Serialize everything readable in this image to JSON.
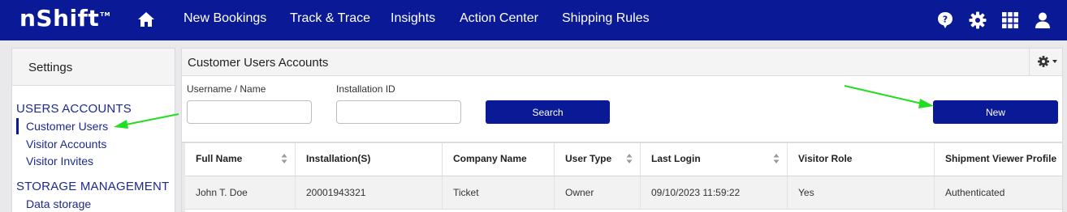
{
  "brand": {
    "logo_text": "nShift",
    "logo_tm": "TM"
  },
  "topnav": {
    "items": [
      {
        "label": "New Bookings"
      },
      {
        "label": "Track & Trace"
      },
      {
        "label": "Insights"
      },
      {
        "label": "Action Center"
      },
      {
        "label": "Shipping Rules"
      }
    ],
    "icons": [
      "home-icon",
      "help-icon",
      "settings-gear-icon",
      "apps-grid-icon",
      "user-icon"
    ]
  },
  "sidebar": {
    "title": "Settings",
    "sections": [
      {
        "label": "USERS ACCOUNTS",
        "items": [
          {
            "label": "Customer Users",
            "active": true
          },
          {
            "label": "Visitor Accounts"
          },
          {
            "label": "Visitor Invites"
          }
        ]
      },
      {
        "label": "STORAGE MANAGEMENT",
        "items": [
          {
            "label": "Data storage"
          }
        ]
      }
    ]
  },
  "main": {
    "title": "Customer Users Accounts",
    "gear_menu_icon": "gear-dropdown-icon",
    "filters": {
      "username_label": "Username / Name",
      "username_value": "",
      "installation_label": "Installation ID",
      "installation_value": ""
    },
    "search_label": "Search",
    "new_label": "New",
    "table": {
      "columns": [
        "Full Name",
        "Installation(S)",
        "Company Name",
        "User Type",
        "Last Login",
        "Visitor Role",
        "Shipment Viewer Profile"
      ],
      "rows": [
        [
          "John T. Doe",
          "20001943321",
          "Ticket",
          "Owner",
          "09/10/2023 11:59:22",
          "Yes",
          "Authenticated"
        ]
      ]
    }
  },
  "annotations": {
    "arrow_color": "#22dd22"
  },
  "colors": {
    "nav_bg": "#0a1a96",
    "accent": "#1c2a8e",
    "button": "#0a1a96"
  }
}
